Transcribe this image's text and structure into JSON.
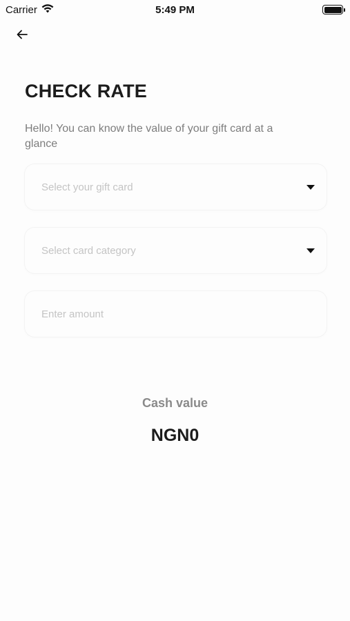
{
  "status_bar": {
    "carrier": "Carrier",
    "time": "5:49 PM"
  },
  "header": {
    "back_icon": "arrow-left-icon"
  },
  "page": {
    "title": "CHECK RATE",
    "subtitle": "Hello! You can know the value of your gift card at a glance"
  },
  "form": {
    "gift_card_placeholder": "Select your gift card",
    "card_category_placeholder": "Select card category",
    "amount_placeholder": "Enter amount",
    "amount_value": ""
  },
  "result": {
    "label": "Cash value",
    "value": "NGN0"
  },
  "colors": {
    "background": "#fdfdfd",
    "title": "#1c1c1c",
    "subtitle": "#7d7d7d",
    "placeholder": "#c4c4c4",
    "cash_label": "#8a8a8a"
  }
}
